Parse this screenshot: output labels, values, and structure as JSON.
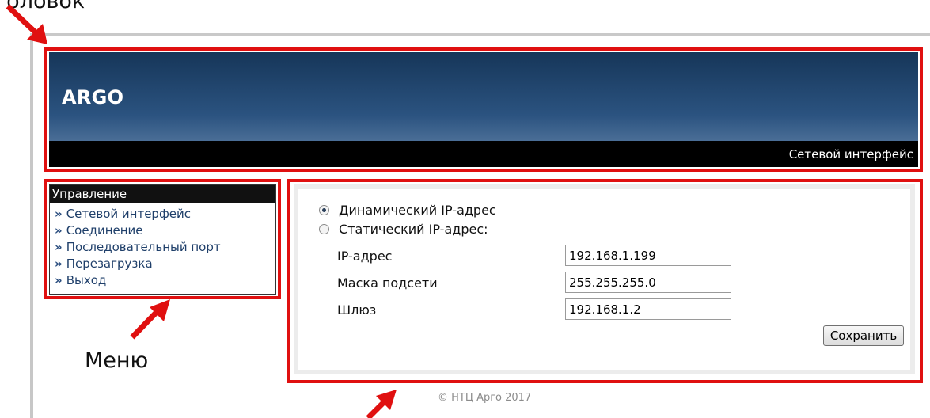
{
  "annotations": {
    "top_label": "головок",
    "menu_label": "Меню"
  },
  "header": {
    "title": "ARGO",
    "current_page": "Сетевой интерфейс"
  },
  "menu": {
    "title": "Управление",
    "bullet": "»",
    "items": [
      {
        "label": "Сетевой интерфейс"
      },
      {
        "label": "Соединение"
      },
      {
        "label": "Последовательный порт"
      },
      {
        "label": "Перезагрузка"
      },
      {
        "label": "Выход"
      }
    ]
  },
  "form": {
    "dynamic_label": "Динамический IP-адрес",
    "static_label": "Статический IP-адрес:",
    "selected_mode": "dynamic",
    "ip_label": "IP-адрес",
    "ip_value": "192.168.1.199",
    "mask_label": "Маска подсети",
    "mask_value": "255.255.255.0",
    "gateway_label": "Шлюз",
    "gateway_value": "192.168.1.2",
    "save_label": "Сохранить"
  },
  "footer": {
    "copyright": "© НТЦ Арго 2017"
  },
  "colors": {
    "annotation_red": "#e01010",
    "header_dark": "#163659",
    "menu_link": "#2a4d7f"
  }
}
